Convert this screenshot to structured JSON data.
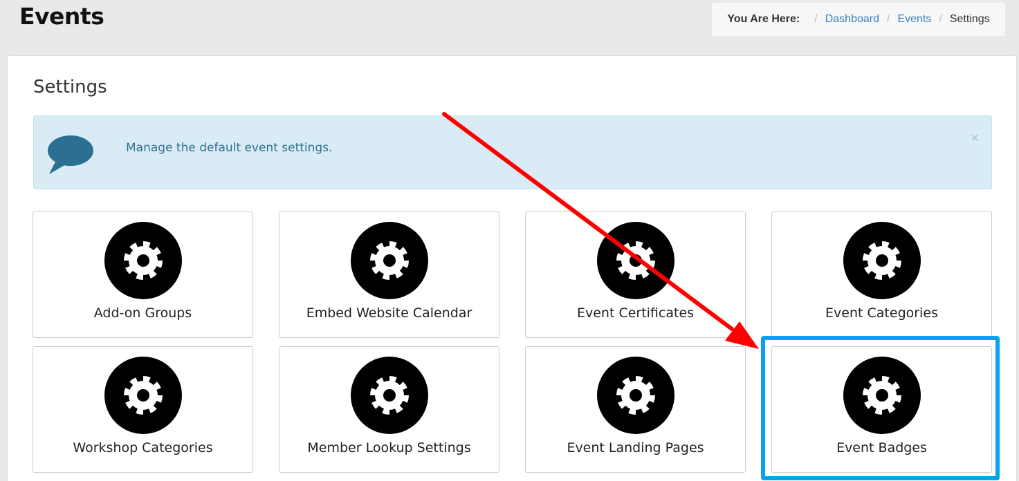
{
  "header": {
    "title": "Events"
  },
  "breadcrumb": {
    "lead": "You Are Here:",
    "items": [
      "Dashboard",
      "Events"
    ],
    "current": "Settings",
    "separator": "/"
  },
  "panel": {
    "title": "Settings"
  },
  "alert": {
    "icon": "speech-bubble-icon",
    "text": "Manage the default event settings.",
    "close": "×"
  },
  "tiles": [
    {
      "label": "Add-on Groups",
      "icon": "gear-icon"
    },
    {
      "label": "Embed Website Calendar",
      "icon": "gear-icon"
    },
    {
      "label": "Event Certificates",
      "icon": "gear-icon"
    },
    {
      "label": "Event Categories",
      "icon": "gear-icon"
    },
    {
      "label": "Workshop Categories",
      "icon": "gear-icon"
    },
    {
      "label": "Member Lookup Settings",
      "icon": "gear-icon"
    },
    {
      "label": "Event Landing Pages",
      "icon": "gear-icon"
    },
    {
      "label": "Event Badges",
      "icon": "gear-icon"
    }
  ],
  "annotations": {
    "highlight_color": "#0aa2f0",
    "arrow_color": "#ff0000",
    "highlighted_tile": "Event Badges"
  },
  "colors": {
    "link": "#3a7fc0",
    "alert_background": "#d9ecf6",
    "alert_text": "#31708f"
  }
}
